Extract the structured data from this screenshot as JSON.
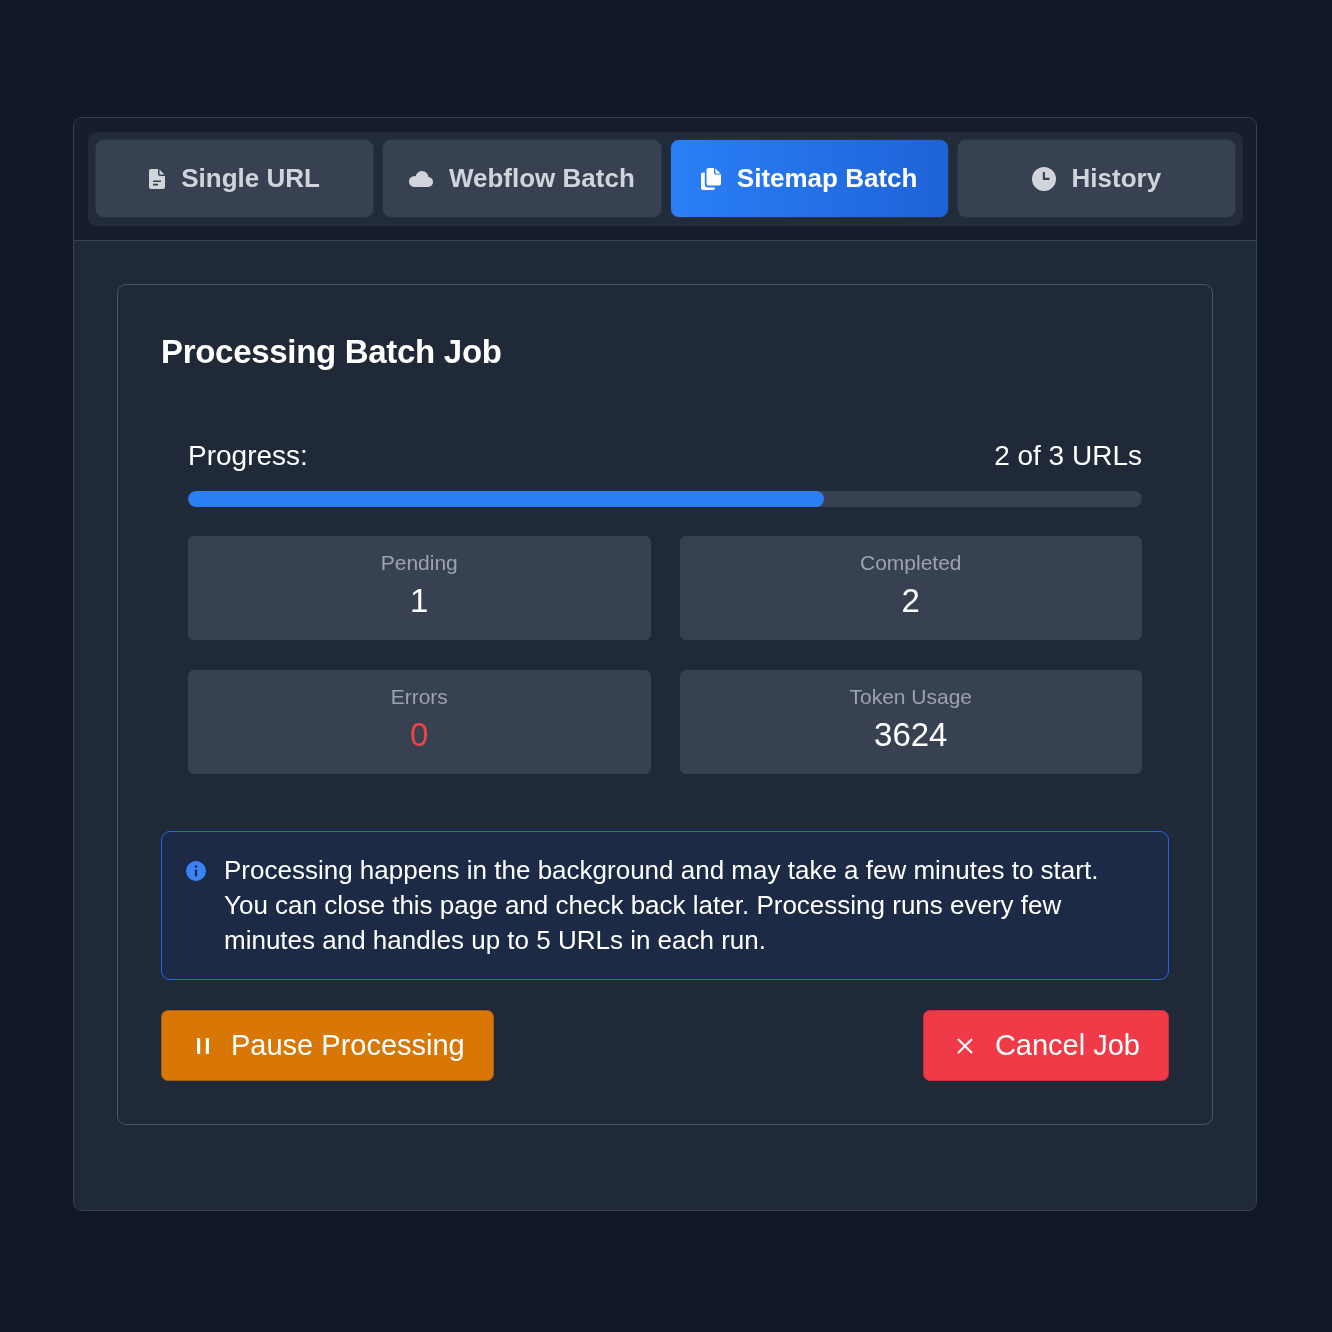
{
  "tabs": [
    {
      "label": "Single URL",
      "selected": false
    },
    {
      "label": "Webflow Batch",
      "selected": false
    },
    {
      "label": "Sitemap Batch",
      "selected": true
    },
    {
      "label": "History",
      "selected": false
    }
  ],
  "job": {
    "title": "Processing Batch Job",
    "progress": {
      "label": "Progress:",
      "reading": "2 of 3 URLs",
      "level": 0.667
    },
    "stats": [
      {
        "label": "Pending",
        "value": "1",
        "kind": "count"
      },
      {
        "label": "Completed",
        "value": "2",
        "kind": "count"
      },
      {
        "label": "Errors",
        "value": "0",
        "kind": "error"
      },
      {
        "label": "Token Usage",
        "value": "3624",
        "kind": "count"
      }
    ],
    "notice": {
      "text": "Processing happens in the background and may take a few minutes to start. You can close this page and check back later. Processing runs every few minutes and handles up to 5 URLs in each run."
    },
    "buttons": [
      {
        "label": "Pause Processing",
        "kind": "pause"
      },
      {
        "label": "Cancel Job",
        "kind": "cancel"
      }
    ]
  }
}
